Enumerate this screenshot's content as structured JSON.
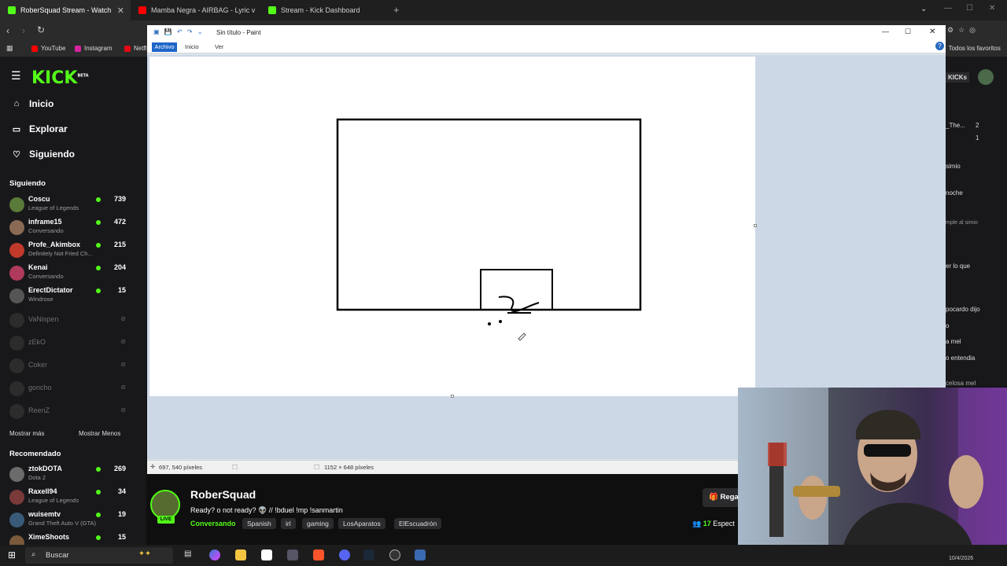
{
  "browser": {
    "tabs": [
      {
        "title": "RoberSquad Stream - Watch",
        "active": true
      },
      {
        "title": "Mamba Negra - AIRBAG - Lyric v",
        "active": false
      },
      {
        "title": "Stream - Kick Dashboard",
        "active": false
      }
    ],
    "bookmarks": [
      "YouTube",
      "Instagram",
      "Netfl"
    ],
    "all_favorites": "Todos los favoritos"
  },
  "kick": {
    "logo": "KICK",
    "logo_badge": "BETA",
    "nav": [
      "Inicio",
      "Explorar",
      "Siguiendo"
    ],
    "following_title": "Siguiendo",
    "following": [
      {
        "name": "Coscu",
        "sub": "League of Legends",
        "viewers": "739",
        "color": "#5a7a3a"
      },
      {
        "name": "inframe15",
        "sub": "Conversando",
        "viewers": "472",
        "color": "#8a6a55"
      },
      {
        "name": "Profe_Akimbox",
        "sub": "Definitely Not Fried Ch...",
        "viewers": "215",
        "color": "#c0392b"
      },
      {
        "name": "Kenai",
        "sub": "Conversando",
        "viewers": "204",
        "color": "#b03a5b"
      },
      {
        "name": "ErectDictator",
        "sub": "Windrose",
        "viewers": "15",
        "color": "#555"
      }
    ],
    "offline": [
      "VaNispen",
      "zEkO",
      "Coker",
      "goncho",
      "ReenZ"
    ],
    "show_more": "Mostrar más",
    "show_less": "Mostrar Menos",
    "recommended_title": "Recomendado",
    "recommended": [
      {
        "name": "ztokDOTA",
        "sub": "Dota 2",
        "viewers": "269",
        "color": "#6b6b6b"
      },
      {
        "name": "Raxell94",
        "sub": "League of Legends",
        "viewers": "34",
        "color": "#7a3a3a"
      },
      {
        "name": "wuisemtv",
        "sub": "Grand Theft Auto V (GTA)",
        "viewers": "19",
        "color": "#3a5a7a"
      },
      {
        "name": "XimeShoots",
        "sub": "",
        "viewers": "15",
        "color": "#7a5a3a"
      }
    ],
    "chat_fragments": [
      "KICKs",
      "_The...",
      "2",
      "1",
      "simio",
      "noche",
      "mple al simio",
      "er lo que",
      "pocardo dijo",
      "o",
      "a mel",
      "o entendia",
      "celosa mel"
    ]
  },
  "paint": {
    "title": "Sin título - Paint",
    "menu": [
      "Archivo",
      "Inicio",
      "Ver"
    ],
    "cursor_pos": "697, 540 píxeles",
    "canvas_size": "1152 × 648 píxeles"
  },
  "stream": {
    "streamer": "RoberSquad",
    "live": "LIVE",
    "title": "Ready? o not ready? 👽 // !bduel !mp !sanmartin",
    "category": "Conversando",
    "tags": [
      "Spanish",
      "irl",
      "gaming",
      "LosAparatos",
      "ElEscuadrón"
    ],
    "gift_label": "Rega",
    "spectators_count": "17",
    "spectators_label": "Espect"
  },
  "taskbar": {
    "search": "Buscar",
    "date": "10/4/2026"
  }
}
